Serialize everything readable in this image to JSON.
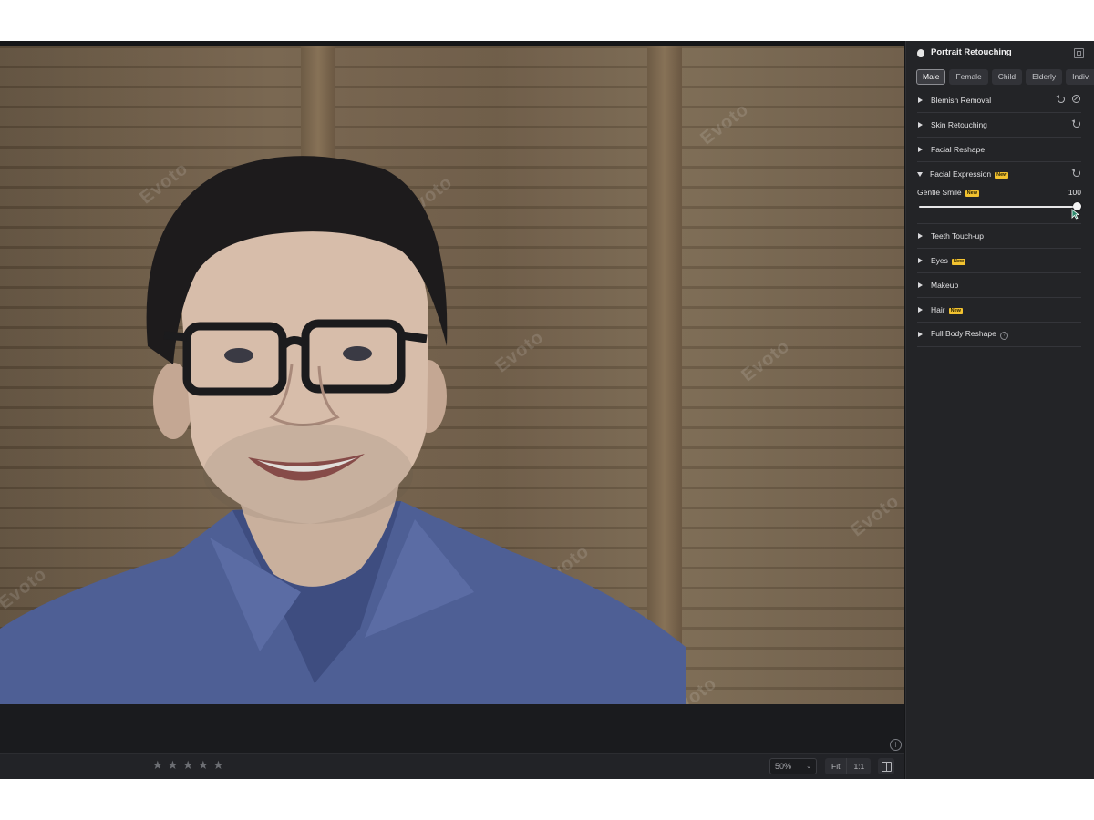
{
  "panel": {
    "title": "Portrait Retouching",
    "tabs": [
      {
        "label": "Male",
        "active": true
      },
      {
        "label": "Female",
        "active": false
      },
      {
        "label": "Child",
        "active": false
      },
      {
        "label": "Elderly",
        "active": false
      },
      {
        "label": "Indiv.",
        "active": false
      }
    ],
    "sections": {
      "blemish": {
        "label": "Blemish Removal"
      },
      "skin": {
        "label": "Skin Retouching"
      },
      "reshape": {
        "label": "Facial Reshape"
      },
      "expression": {
        "label": "Facial Expression",
        "badge": "New"
      },
      "teeth": {
        "label": "Teeth Touch-up"
      },
      "eyes": {
        "label": "Eyes",
        "badge": "New"
      },
      "makeup": {
        "label": "Makeup"
      },
      "hair": {
        "label": "Hair",
        "badge": "New"
      },
      "body": {
        "label": "Full Body Reshape",
        "help_icon": "help-circle-icon"
      }
    },
    "gentle_smile": {
      "label": "Gentle Smile",
      "badge": "New",
      "value": 100,
      "value_text": "100",
      "max": 100
    }
  },
  "canvas": {
    "watermark": "Evoto"
  },
  "bottombar": {
    "rating_stars": 5,
    "zoom": "50%",
    "fit_label": "Fit",
    "one_to_one_label": "1:1",
    "compare_icon": "split-view-icon"
  },
  "colors": {
    "badge": "#f2c230",
    "panel_bg": "#232427",
    "app_bg": "#151618"
  }
}
